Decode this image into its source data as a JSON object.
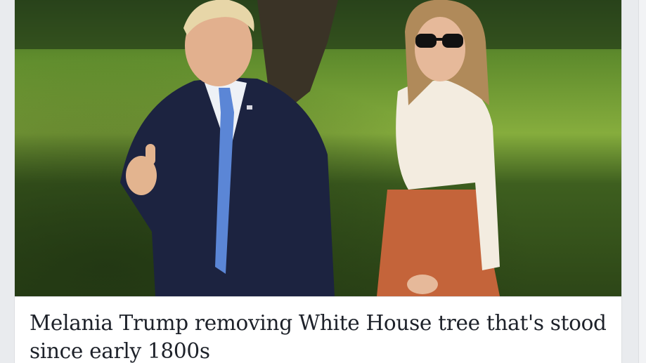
{
  "article": {
    "headline": "Melania Trump removing White House tree that's stood since early 1800s"
  },
  "colors": {
    "background": "#e9ebee",
    "card": "#ffffff",
    "headline_text": "#1d2129"
  }
}
